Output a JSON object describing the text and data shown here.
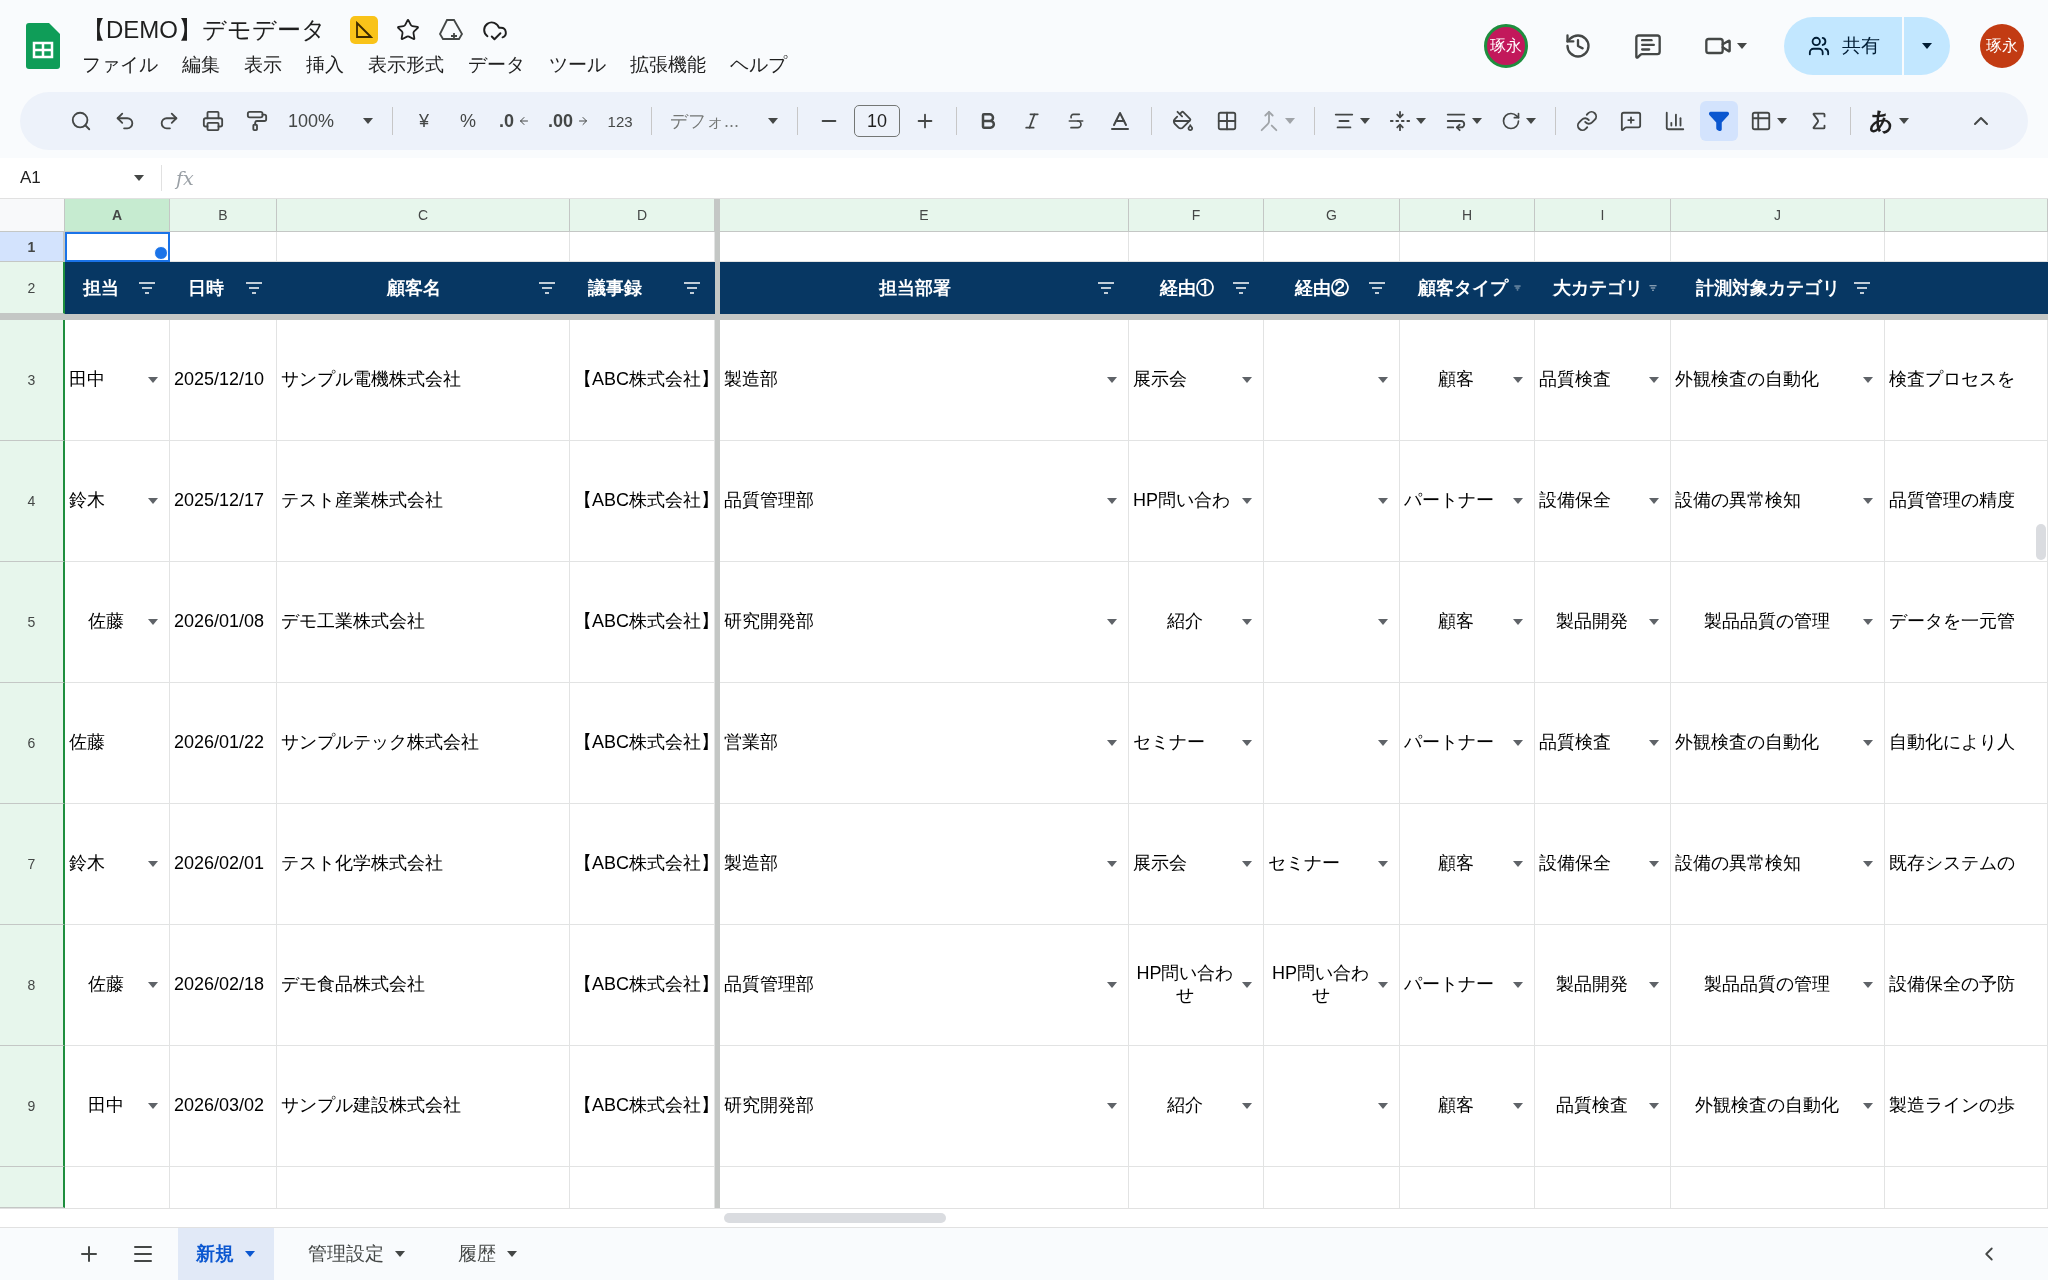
{
  "document": {
    "title": "【DEMO】デモデータ"
  },
  "menu": [
    "ファイル",
    "編集",
    "表示",
    "挿入",
    "表示形式",
    "データ",
    "ツール",
    "拡張機能",
    "ヘルプ"
  ],
  "account": {
    "collaborator": "琢永",
    "share": "共有",
    "user": "琢永"
  },
  "toolbar": {
    "zoom": "100%",
    "currency": "¥",
    "percent": "%",
    "decrease_decimal": ".0",
    "increase_decimal": ".00",
    "number_format": "123",
    "font": "デフォ...",
    "font_size": "10",
    "input_tools": "あ",
    "filter_active": true
  },
  "formula_bar": {
    "name_box": "A1",
    "fx": "fx"
  },
  "columns": [
    {
      "letter": "A",
      "selected": true
    },
    {
      "letter": "B",
      "selected": false
    },
    {
      "letter": "C",
      "selected": false
    },
    {
      "letter": "D",
      "selected": false
    },
    {
      "letter": "E",
      "selected": false
    },
    {
      "letter": "F",
      "selected": false
    },
    {
      "letter": "G",
      "selected": false
    },
    {
      "letter": "H",
      "selected": false
    },
    {
      "letter": "I",
      "selected": false
    },
    {
      "letter": "J",
      "selected": false
    }
  ],
  "top_rows": [
    {
      "number": "1",
      "selected": true
    },
    {
      "number": "2",
      "selected": false
    }
  ],
  "header": [
    "担当",
    "日時",
    "顧客名",
    "議事録",
    "担当部署",
    "経由①",
    "経由②",
    "顧客タイプ",
    "大カテゴリ",
    "計測対象カテゴリ"
  ],
  "rows": [
    {
      "number": "3",
      "cells": [
        {
          "text": "田中",
          "dropdown": true,
          "centered": false
        },
        {
          "text": "2025/12/10",
          "dropdown": false,
          "centered": false
        },
        {
          "text": "サンプル電機株式会社",
          "dropdown": false,
          "centered": false
        },
        {
          "text": "【ABC株式会社】",
          "dropdown": false
        },
        {
          "text": "製造部",
          "dropdown": true,
          "centered": false
        },
        {
          "text": "展示会",
          "dropdown": true,
          "centered": false
        },
        {
          "dropdown": true
        },
        {
          "text": "顧客",
          "dropdown": true,
          "centered": true
        },
        {
          "text": "品質検査",
          "dropdown": true,
          "centered": false
        },
        {
          "text": "外観検査の自動化",
          "dropdown": true,
          "centered": false
        },
        {
          "text": "検査プロセスを",
          "dropdown": false,
          "centered": false
        }
      ]
    },
    {
      "number": "4",
      "cells": [
        {
          "text": "鈴木",
          "dropdown": true,
          "centered": false
        },
        {
          "text": "2025/12/17",
          "dropdown": false,
          "centered": false
        },
        {
          "text": "テスト産業株式会社",
          "dropdown": false,
          "centered": false
        },
        {
          "text": "【ABC株式会社】",
          "dropdown": false
        },
        {
          "text": "品質管理部",
          "dropdown": true,
          "centered": false
        },
        {
          "text": "HP問い合わ",
          "dropdown": true,
          "centered": false
        },
        {
          "dropdown": true
        },
        {
          "text": "パートナー",
          "dropdown": true,
          "centered": false
        },
        {
          "text": "設備保全",
          "dropdown": true,
          "centered": false
        },
        {
          "text": "設備の異常検知",
          "dropdown": true,
          "centered": false
        },
        {
          "text": "品質管理の精度",
          "dropdown": false,
          "centered": false
        }
      ]
    },
    {
      "number": "5",
      "cells": [
        {
          "text": "佐藤",
          "dropdown": true,
          "centered": true
        },
        {
          "text": "2026/01/08",
          "dropdown": false,
          "centered": false
        },
        {
          "text": "デモ工業株式会社",
          "dropdown": false,
          "centered": false
        },
        {
          "text": "【ABC株式会社】",
          "dropdown": false
        },
        {
          "text": "研究開発部",
          "dropdown": true,
          "centered": false
        },
        {
          "text": "紹介",
          "dropdown": true,
          "centered": true
        },
        {
          "dropdown": true
        },
        {
          "text": "顧客",
          "dropdown": true,
          "centered": true
        },
        {
          "text": "製品開発",
          "dropdown": true,
          "centered": true
        },
        {
          "text": "製品品質の管理",
          "dropdown": true,
          "centered": true
        },
        {
          "text": "データを一元管",
          "dropdown": false,
          "centered": false
        }
      ]
    },
    {
      "number": "6",
      "cells": [
        {
          "text": "佐藤",
          "dropdown": false,
          "centered": false
        },
        {
          "text": "2026/01/22",
          "dropdown": false,
          "centered": false
        },
        {
          "text": "サンプルテック株式会社",
          "dropdown": false,
          "centered": false
        },
        {
          "text": "【ABC株式会社】",
          "dropdown": false
        },
        {
          "text": "営業部",
          "dropdown": true,
          "centered": false
        },
        {
          "text": "セミナー",
          "dropdown": true,
          "centered": false
        },
        {
          "dropdown": true
        },
        {
          "text": "パートナー",
          "dropdown": true,
          "centered": false
        },
        {
          "text": "品質検査",
          "dropdown": true,
          "centered": false
        },
        {
          "text": "外観検査の自動化",
          "dropdown": true,
          "centered": false
        },
        {
          "text": "自動化により人",
          "dropdown": false,
          "centered": false
        }
      ]
    },
    {
      "number": "7",
      "cells": [
        {
          "text": "鈴木",
          "dropdown": true,
          "centered": false
        },
        {
          "text": "2026/02/01",
          "dropdown": false,
          "centered": false
        },
        {
          "text": "テスト化学株式会社",
          "dropdown": false,
          "centered": false
        },
        {
          "text": "【ABC株式会社】",
          "dropdown": false
        },
        {
          "text": "製造部",
          "dropdown": true,
          "centered": false
        },
        {
          "text": "展示会",
          "dropdown": true,
          "centered": false
        },
        {
          "text": "セミナー",
          "dropdown": true,
          "centered": false
        },
        {
          "text": "顧客",
          "dropdown": true,
          "centered": true
        },
        {
          "text": "設備保全",
          "dropdown": true,
          "centered": false
        },
        {
          "text": "設備の異常検知",
          "dropdown": true,
          "centered": false
        },
        {
          "text": "既存システムの",
          "dropdown": false,
          "centered": false
        }
      ]
    },
    {
      "number": "8",
      "cells": [
        {
          "text": "佐藤",
          "dropdown": true,
          "centered": true
        },
        {
          "text": "2026/02/18",
          "dropdown": false,
          "centered": false
        },
        {
          "text": "デモ食品株式会社",
          "dropdown": false,
          "centered": false
        },
        {
          "text": "【ABC株式会社】",
          "dropdown": false
        },
        {
          "text": "品質管理部",
          "dropdown": true,
          "centered": false
        },
        {
          "text": "HP問い合わせ",
          "dropdown": true,
          "centered": true
        },
        {
          "text": "HP問い合わせ",
          "dropdown": true,
          "centered": true
        },
        {
          "text": "パートナー",
          "dropdown": true,
          "centered": false
        },
        {
          "text": "製品開発",
          "dropdown": true,
          "centered": true
        },
        {
          "text": "製品品質の管理",
          "dropdown": true,
          "centered": true
        },
        {
          "text": "設備保全の予防",
          "dropdown": false,
          "centered": false
        }
      ]
    },
    {
      "number": "9",
      "cells": [
        {
          "text": "田中",
          "dropdown": true,
          "centered": true
        },
        {
          "text": "2026/03/02",
          "dropdown": false,
          "centered": false
        },
        {
          "text": "サンプル建設株式会社",
          "dropdown": false,
          "centered": false
        },
        {
          "text": "【ABC株式会社】",
          "dropdown": false
        },
        {
          "text": "研究開発部",
          "dropdown": true,
          "centered": false
        },
        {
          "text": "紹介",
          "dropdown": true,
          "centered": true
        },
        {
          "dropdown": true
        },
        {
          "text": "顧客",
          "dropdown": true,
          "centered": true
        },
        {
          "text": "品質検査",
          "dropdown": true,
          "centered": true
        },
        {
          "text": "外観検査の自動化",
          "dropdown": true,
          "centered": true
        },
        {
          "text": "製造ラインの歩",
          "dropdown": false,
          "centered": false
        }
      ]
    }
  ],
  "sheets": [
    {
      "name": "新規",
      "selected": true
    },
    {
      "name": "管理設定",
      "selected": false
    },
    {
      "name": "履歴",
      "selected": false
    }
  ]
}
